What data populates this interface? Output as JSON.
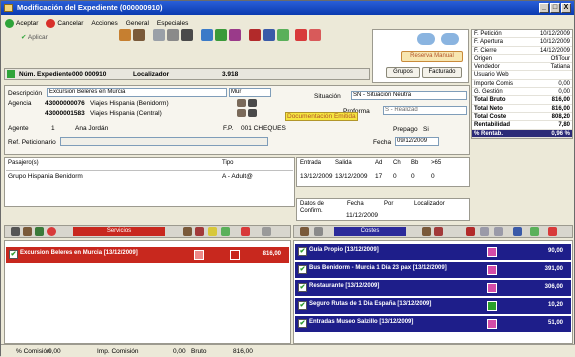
{
  "window": {
    "title": "Modificación del Expediente (000000910)",
    "minimize": "_",
    "maximize": "□",
    "close": "X"
  },
  "menu": {
    "aceptar": "Aceptar",
    "cancelar": "Cancelar",
    "acciones": "Acciones",
    "general": "General",
    "especiales": "Especiales",
    "aplicar": "Aplicar"
  },
  "header": {
    "num_expediente_label": "Núm. Expediente",
    "num_expediente": "000 000910",
    "localizador_label": "Localizador",
    "localizador": "3.918"
  },
  "buttons": {
    "reserva_manual": "Reserva Manual",
    "grupos": "Grupos",
    "facturado": "Facturado"
  },
  "summary": {
    "rows": [
      {
        "label": "F. Petición",
        "value": "10/12/2009"
      },
      {
        "label": "F. Apertura",
        "value": "10/12/2009"
      },
      {
        "label": "F. Cierre",
        "value": "14/12/2009"
      },
      {
        "label": "Origen",
        "value": "OfiTour"
      },
      {
        "label": "Vendedor",
        "value": "Tatiana"
      },
      {
        "label": "Usuario Web",
        "value": ""
      },
      {
        "label": "Importe Comis",
        "value": "0,00"
      },
      {
        "label": "G. Gestión",
        "value": "0,00"
      }
    ],
    "totals": [
      {
        "label": "Total Bruto",
        "value": "816,00"
      },
      {
        "label": "Total Neto",
        "value": "816,00"
      },
      {
        "label": "Total Coste",
        "value": "808,20"
      },
      {
        "label": "Rentabilidad",
        "value": "7,80"
      },
      {
        "label": "% Rentab.",
        "value": "0,96 %"
      }
    ]
  },
  "details": {
    "descripcion_label": "Descripción",
    "descripcion": "Excursion Beleres en Murcia",
    "mur": "Mur",
    "agencia_label": "Agencia",
    "agencia1_code": "43000000076",
    "agencia1_name": "Viajes Hispania (Benidorm)",
    "agencia2_code": "43000001583",
    "agencia2_name": "Viajes Hispania (Central)",
    "agente_label": "Agente",
    "agente_num": "1",
    "agente_name": "Ana Jordán",
    "fp_label": "F.P.",
    "fp_value": "001 CHEQUES",
    "ref_label": "Ref. Peticionario",
    "situacion_label": "Situación",
    "situacion": "SN - Situación Neutra",
    "proforma_label": "Proforma",
    "proforma": "S - Realizad",
    "doc_emitida": "Documentación Emitida",
    "prepago_label": "Prepago",
    "prepago": "Si",
    "fecha_label": "Fecha",
    "fecha": "09/12/2009"
  },
  "pasajeros": {
    "headers": [
      "Pasajero(s)",
      "Tipo"
    ],
    "rows": [
      {
        "name": "Grupo Hispania Benidorm",
        "tipo": "A - Adult@"
      }
    ]
  },
  "fechas": {
    "headers": [
      "Entrada",
      "Salida",
      "Ad",
      "Ch",
      "Bb",
      ">65"
    ],
    "row": [
      "13/12/2009",
      "13/12/2009",
      "17",
      "0",
      "0",
      "0"
    ]
  },
  "confirm": {
    "headers": [
      "Datos de Confirm.",
      "Fecha",
      "Por",
      "Localizador"
    ],
    "fecha": "11/12/2009"
  },
  "servicios": {
    "label": "Servicios",
    "items": [
      {
        "text": "Excursion Beleres en Murcia [13/12/2009]",
        "amount": "816,00"
      }
    ]
  },
  "costes": {
    "label": "Costes",
    "items": [
      {
        "text": "Guía Propio [13/12/2009]",
        "amount": "90,00",
        "icon_color": "#d44ca8"
      },
      {
        "text": "Bus Benidorm - Murcia 1 Día 23 pax [13/12/2009]",
        "amount": "391,00",
        "icon_color": "#d44ca8"
      },
      {
        "text": "Restaurante [13/12/2009]",
        "amount": "306,00",
        "icon_color": "#d44ca8"
      },
      {
        "text": "Seguro Rutas de 1 Día España [13/12/2009]",
        "amount": "10,20",
        "icon_color": "#2aa02a"
      },
      {
        "text": "Entradas Museo Salzillo [13/12/2009]",
        "amount": "51,00",
        "icon_color": "#d44ca8"
      }
    ]
  },
  "footer": {
    "comision_label": "% Comisión",
    "comision": "0,00",
    "imp_comision_label": "Imp. Comisión",
    "imp_comision": "0,00",
    "bruto_label": "Bruto",
    "bruto": "816,00"
  }
}
